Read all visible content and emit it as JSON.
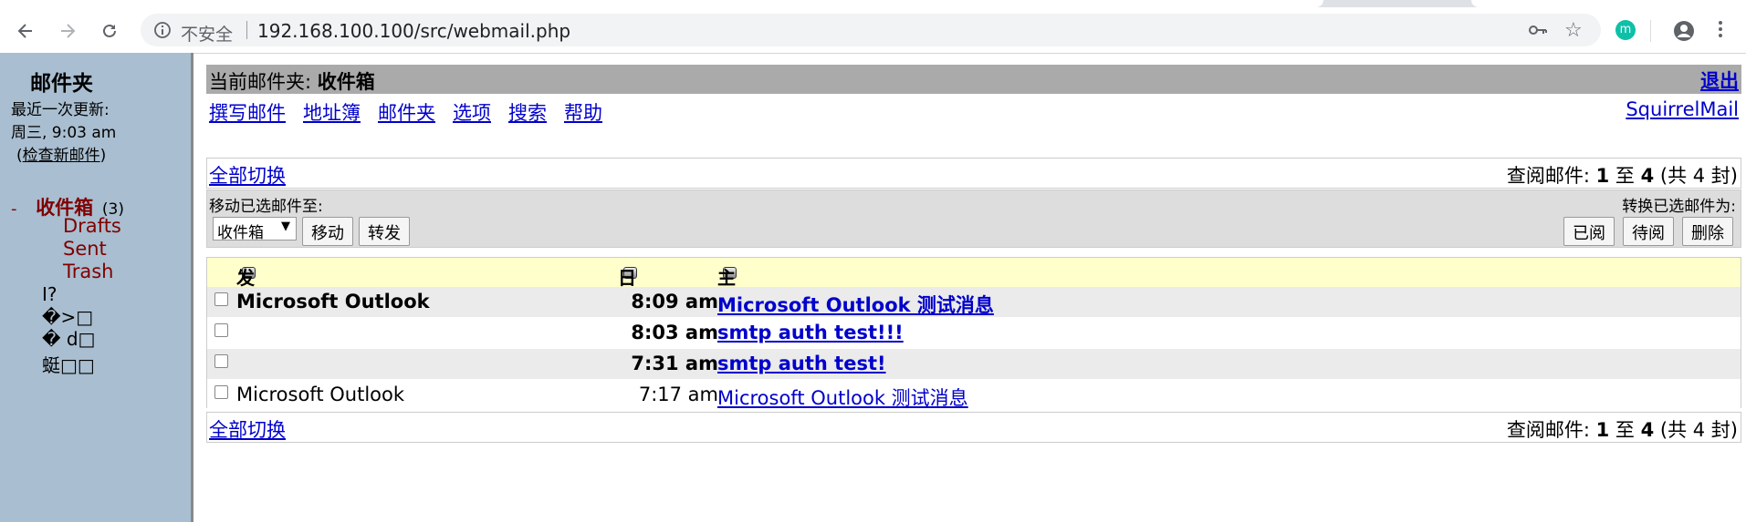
{
  "browser": {
    "security_label": "不安全",
    "url": "192.168.100.100/src/webmail.php",
    "extension_letter": "m"
  },
  "sidebar": {
    "title": "邮件夹",
    "last_update_label": "最近一次更新:",
    "last_update_time": "周三, 9:03 am",
    "check_open": "(",
    "check_link": "检查新邮件",
    "check_close": ")",
    "inbox_toggle": "-",
    "inbox_label": "收件箱",
    "inbox_count": "(3)",
    "subfolders": [
      "Drafts",
      "Sent",
      "Trash"
    ],
    "garbled_folders": [
      "I?",
      "�>□",
      "� d□",
      "蜓□□"
    ]
  },
  "main": {
    "current_folder_label": "当前邮件夹: ",
    "current_folder": "收件箱",
    "logout": "退出",
    "nav_links": [
      "撰写邮件",
      "地址簿",
      "邮件夹",
      "选项",
      "搜索",
      "帮助"
    ],
    "brand_link": "SquirrelMail",
    "toggle_all": "全部切换",
    "view_prefix": "查阅邮件: ",
    "view_from": "1",
    "view_to_word": " 至 ",
    "view_to": "4",
    "view_total": " (共 4 封)",
    "move_label": "移动已选邮件至:",
    "move_select_value": "收件箱",
    "move_button": "移动",
    "forward_button": "转发",
    "convert_label": "转换已选邮件为:",
    "read_button": "已阅",
    "unread_button": "待阅",
    "delete_button": "删除",
    "columns": {
      "from": "发件人",
      "date": "日期",
      "subject": "主题"
    },
    "messages": [
      {
        "from": "Microsoft Outlook",
        "date": "8:09 am",
        "subject": "Microsoft Outlook 测试消息",
        "unread": true
      },
      {
        "from": "",
        "date": "8:03 am",
        "subject": "smtp auth test!!!",
        "unread": true
      },
      {
        "from": "",
        "date": "7:31 am",
        "subject": "smtp auth test!",
        "unread": true
      },
      {
        "from": "Microsoft Outlook",
        "date": "7:17 am",
        "subject": "Microsoft Outlook 测试消息",
        "unread": false
      }
    ]
  }
}
